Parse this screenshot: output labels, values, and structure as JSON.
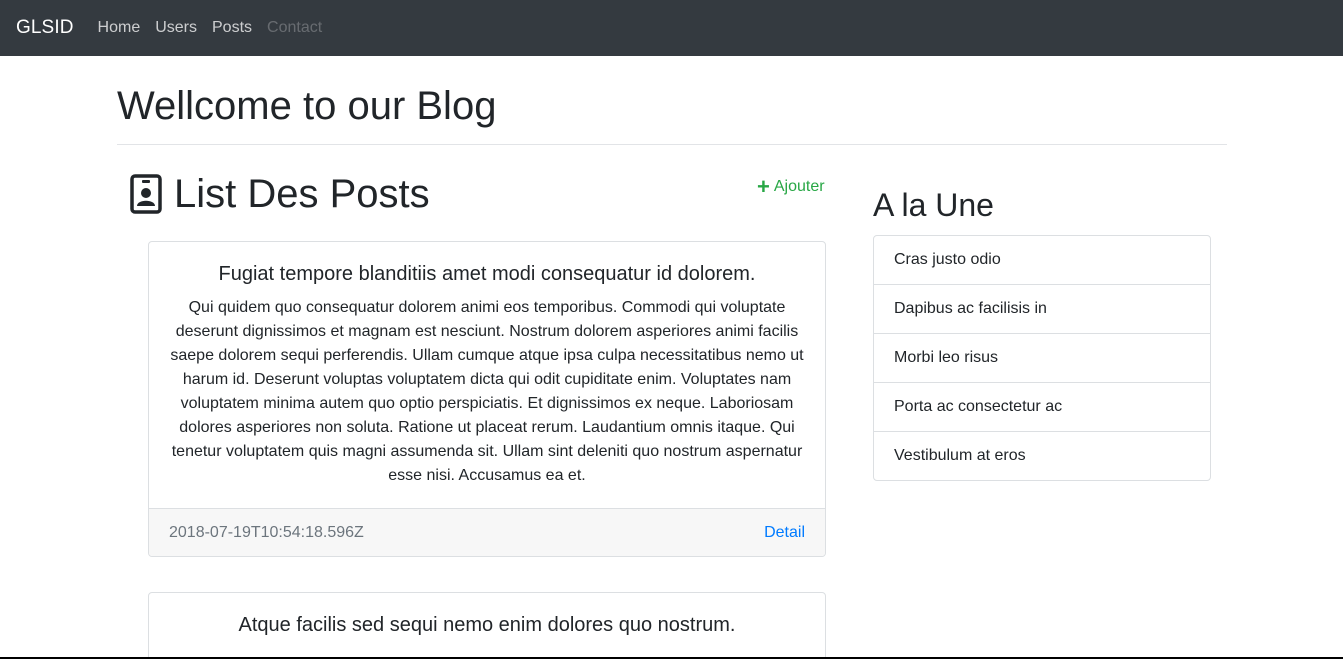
{
  "navbar": {
    "brand": "GLSID",
    "links": [
      {
        "label": "Home"
      },
      {
        "label": "Users"
      },
      {
        "label": "Posts"
      },
      {
        "label": "Contact"
      }
    ]
  },
  "header": {
    "title": "Wellcome to our Blog"
  },
  "posts_section": {
    "title": "List Des Posts",
    "add_label": "Ajouter",
    "icon": "contact-card-icon",
    "posts": [
      {
        "title": "Fugiat tempore blanditiis amet modi consequatur id dolorem.",
        "body": "Qui quidem quo consequatur dolorem animi eos temporibus. Commodi qui voluptate deserunt dignissimos et magnam est nesciunt. Nostrum dolorem asperiores animi facilis saepe dolorem sequi perferendis. Ullam cumque atque ipsa culpa necessitatibus nemo ut harum id. Deserunt voluptas voluptatem dicta qui odit cupiditate enim. Voluptates nam voluptatem minima autem quo optio perspiciatis. Et dignissimos ex neque. Laboriosam dolores asperiores non soluta. Ratione ut placeat rerum. Laudantium omnis itaque. Qui tenetur voluptatem quis magni assumenda sit. Ullam sint deleniti quo nostrum aspernatur esse nisi. Accusamus ea et.",
        "date": "2018-07-19T10:54:18.596Z",
        "link_label": "Detail"
      },
      {
        "title": "Atque facilis sed sequi nemo enim dolores quo nostrum.",
        "body": "",
        "date": "",
        "link_label": ""
      }
    ]
  },
  "sidebar": {
    "title": "A la Une",
    "items": [
      {
        "label": "Cras justo odio"
      },
      {
        "label": "Dapibus ac facilisis in"
      },
      {
        "label": "Morbi leo risus"
      },
      {
        "label": "Porta ac consectetur ac"
      },
      {
        "label": "Vestibulum at eros"
      }
    ]
  },
  "colors": {
    "navbar_bg": "#343a40",
    "add_link": "#28a745",
    "detail_link": "#007bff"
  }
}
